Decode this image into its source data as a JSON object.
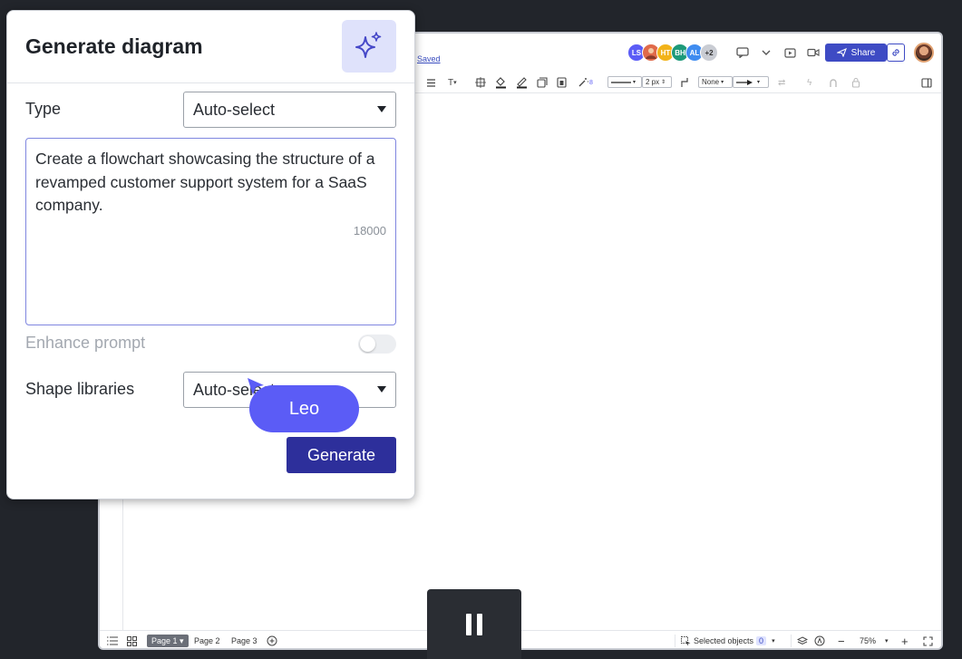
{
  "editor": {
    "saved_label": "Saved",
    "collaborators": [
      {
        "initials": "LS",
        "color": "#5b5cf6"
      },
      {
        "initials": "",
        "color": "#e06a4a"
      },
      {
        "initials": "HT",
        "color": "#f2b319"
      },
      {
        "initials": "BH",
        "color": "#1d9a7a"
      },
      {
        "initials": "AL",
        "color": "#3f8cf0"
      },
      {
        "initials": "+2",
        "color": "#c9ccd3"
      }
    ],
    "share_label": "Share",
    "toolbar": {
      "line_width": "2 px",
      "arrow_start": "None"
    },
    "bottom": {
      "pages": [
        "Page 1",
        "Page 2",
        "Page 3"
      ],
      "selected_objects_label": "Selected objects",
      "selected_count": "0",
      "zoom": "75%"
    }
  },
  "panel": {
    "title": "Generate diagram",
    "type_label": "Type",
    "type_value": "Auto-select",
    "prompt_text": "Create a flowchart showcasing the structure of a revamped customer support system for a SaaS company.",
    "char_count": "18000",
    "enhance_label": "Enhance prompt",
    "shape_libraries_label": "Shape libraries",
    "shape_libraries_value": "Auto-select",
    "generate_label": "Generate"
  },
  "cursor": {
    "name": "Leo",
    "color": "#5b5cf6"
  },
  "accent_colors": {
    "primary": "#2d2f9b",
    "share": "#3e4bc4"
  }
}
